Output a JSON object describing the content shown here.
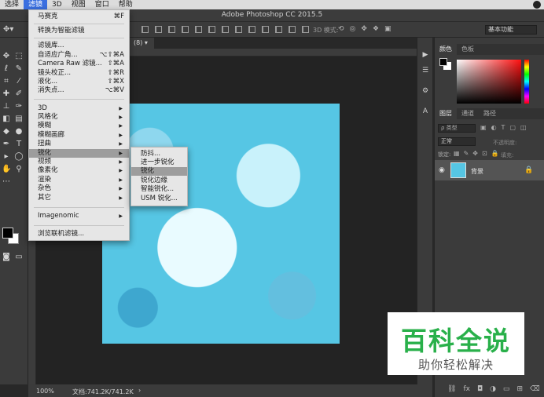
{
  "menubar": {
    "items": [
      "选择",
      "滤镜",
      "3D",
      "视图",
      "窗口",
      "帮助"
    ],
    "active_index": 1
  },
  "window": {
    "title": "Adobe Photoshop CC 2015.5"
  },
  "options_bar": {
    "mode_3d": "3D 模式:",
    "workspace": "基本功能"
  },
  "document": {
    "tab_label": "(8)",
    "zoom": "100%",
    "doc_info": "文档:741.2K/741.2K"
  },
  "filter_menu": {
    "items": [
      {
        "label": "马赛克",
        "shortcut": "⌘F"
      },
      {
        "label": "转换为智能滤镜"
      },
      {
        "label": "滤镜库..."
      },
      {
        "label": "自适应广角...",
        "shortcut": "⌥⇧⌘A"
      },
      {
        "label": "Camera Raw 滤镜...",
        "shortcut": "⇧⌘A"
      },
      {
        "label": "镜头校正...",
        "shortcut": "⇧⌘R"
      },
      {
        "label": "液化...",
        "shortcut": "⇧⌘X"
      },
      {
        "label": "消失点...",
        "shortcut": "⌥⌘V"
      },
      {
        "label": "3D",
        "submenu": true
      },
      {
        "label": "风格化",
        "submenu": true
      },
      {
        "label": "模糊",
        "submenu": true
      },
      {
        "label": "模糊画廊",
        "submenu": true
      },
      {
        "label": "扭曲",
        "submenu": true
      },
      {
        "label": "锐化",
        "submenu": true,
        "highlighted": true
      },
      {
        "label": "视频",
        "submenu": true
      },
      {
        "label": "像素化",
        "submenu": true
      },
      {
        "label": "渲染",
        "submenu": true
      },
      {
        "label": "杂色",
        "submenu": true
      },
      {
        "label": "其它",
        "submenu": true
      },
      {
        "label": "Imagenomic",
        "submenu": true
      },
      {
        "label": "浏览联机滤镜..."
      }
    ]
  },
  "sharpen_submenu": {
    "items": [
      {
        "label": "防抖..."
      },
      {
        "label": "进一步锐化"
      },
      {
        "label": "锐化",
        "highlighted": true
      },
      {
        "label": "锐化边缘"
      },
      {
        "label": "智能锐化..."
      },
      {
        "label": "USM 锐化..."
      }
    ]
  },
  "color_panel": {
    "tabs": [
      "颜色",
      "色板"
    ],
    "active": 0
  },
  "layers_panel": {
    "tabs": [
      "图层",
      "通道",
      "路径"
    ],
    "active": 0,
    "filter_placeholder": "ρ 类型",
    "blend_mode": "正常",
    "opacity_label": "不透明度:",
    "lock_label": "锁定:",
    "fill_label": "填充:",
    "layers": [
      {
        "name": "背景",
        "locked": true,
        "visible": true
      }
    ]
  },
  "watermark": {
    "line1": "百科全说",
    "line2": "助你轻松解决"
  }
}
